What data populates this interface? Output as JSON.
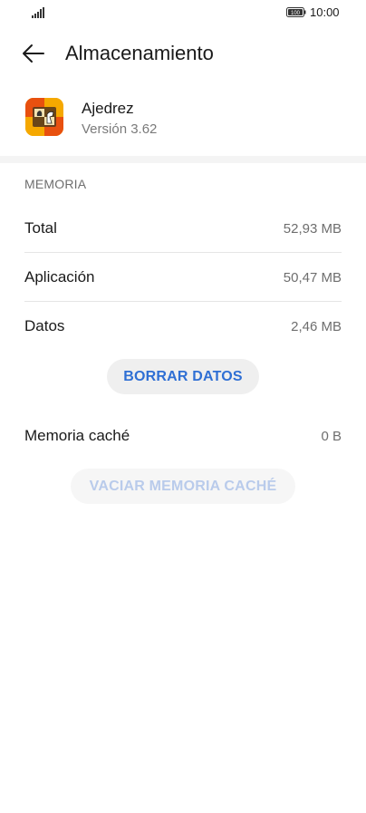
{
  "status_bar": {
    "time": "10:00",
    "battery_level": "100"
  },
  "header": {
    "title": "Almacenamiento",
    "back_icon": "arrow-left-icon"
  },
  "app": {
    "name": "Ajedrez",
    "version": "Versión 3.62",
    "icon": "chess-app-icon"
  },
  "memory": {
    "section_label": "MEMORIA",
    "rows": [
      {
        "label": "Total",
        "value": "52,93 MB"
      },
      {
        "label": "Aplicación",
        "value": "50,47 MB"
      },
      {
        "label": "Datos",
        "value": "2,46 MB"
      }
    ],
    "clear_data_label": "BORRAR DATOS"
  },
  "cache": {
    "label": "Memoria caché",
    "value": "0 B",
    "clear_cache_label": "VACIAR MEMORIA CACHÉ"
  },
  "colors": {
    "accent": "#2f6fd4",
    "disabled_accent": "#b9cbeb"
  }
}
